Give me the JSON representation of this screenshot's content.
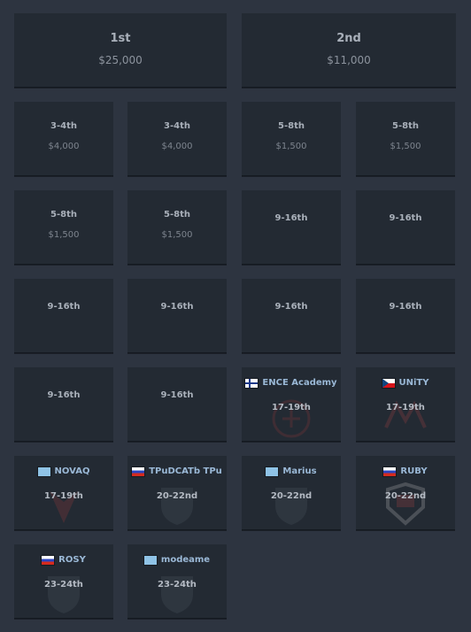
{
  "top": [
    {
      "place": "1st",
      "prize": "$25,000"
    },
    {
      "place": "2nd",
      "prize": "$11,000"
    }
  ],
  "rows": [
    [
      {
        "place": "3-4th",
        "prize": "$4,000"
      },
      {
        "place": "3-4th",
        "prize": "$4,000"
      },
      {
        "place": "5-8th",
        "prize": "$1,500"
      },
      {
        "place": "5-8th",
        "prize": "$1,500"
      }
    ],
    [
      {
        "place": "5-8th",
        "prize": "$1,500"
      },
      {
        "place": "5-8th",
        "prize": "$1,500"
      },
      {
        "place": "9-16th"
      },
      {
        "place": "9-16th"
      }
    ],
    [
      {
        "place": "9-16th"
      },
      {
        "place": "9-16th"
      },
      {
        "place": "9-16th"
      },
      {
        "place": "9-16th"
      }
    ],
    [
      {
        "place": "9-16th"
      },
      {
        "place": "9-16th"
      },
      {
        "place": "17-19th",
        "team": "ENCE Academy",
        "flag": "fi"
      },
      {
        "place": "17-19th",
        "team": "UNiTY",
        "flag": "cz"
      }
    ],
    [
      {
        "place": "17-19th",
        "team": "NOVAQ",
        "flag": "un"
      },
      {
        "place": "20-22nd",
        "team": "TPuDCATb TPu",
        "flag": "ru"
      },
      {
        "place": "20-22nd",
        "team": "Marius",
        "flag": "un"
      },
      {
        "place": "20-22nd",
        "team": "RUBY",
        "flag": "ru"
      }
    ],
    [
      {
        "place": "23-24th",
        "team": "ROSY",
        "flag": "ru"
      },
      {
        "place": "23-24th",
        "team": "modeame",
        "flag": "un"
      }
    ]
  ],
  "colors": {
    "background": "#2d3440",
    "card": "#232a33",
    "team_text": "#9ab8d6"
  }
}
